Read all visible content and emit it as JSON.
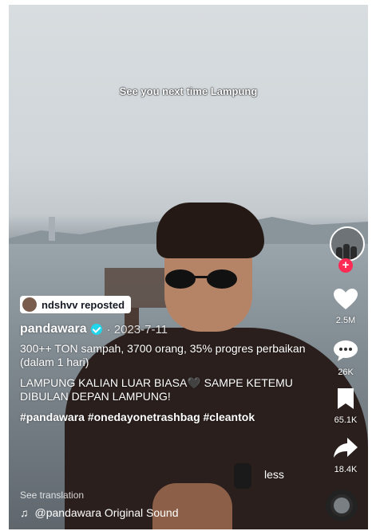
{
  "video": {
    "overlay_caption": "See you next time Lampung"
  },
  "sidebar": {
    "avatar_icon": "creator-avatar",
    "follow_icon": "plus-icon",
    "follow_symbol": "+",
    "like_count": "2.5M",
    "comment_count": "26K",
    "save_count": "65.1K",
    "share_count": "18.4K"
  },
  "post": {
    "repost_label": "ndshvv reposted",
    "author": "pandawara",
    "date": "· 2023-7-11",
    "description_line1": "300++ TON sampah, 3700 orang, 35% progres perbaikan (dalam 1 hari)",
    "description_line2": "LAMPUNG KALIAN LUAR BIASA🖤 SAMPE KETEMU DIBULAN DEPAN LAMPUNG!",
    "hashtags": "#pandawara #onedayonetrashbag #cleantok",
    "less_label": "less",
    "translation_label": "See translation",
    "sound_label": "@pandawara Original Sound"
  },
  "colors": {
    "accent": "#fe2c55",
    "verified": "#20d5ec"
  }
}
